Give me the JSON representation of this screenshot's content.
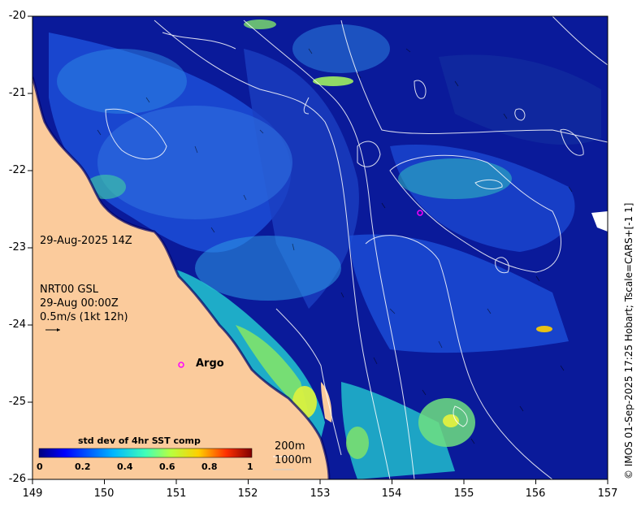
{
  "map": {
    "y_ticks": [
      "-20",
      "-21",
      "-22",
      "-23",
      "-24",
      "-25",
      "-26"
    ],
    "x_ticks": [
      "149",
      "150",
      "151",
      "152",
      "153",
      "154",
      "155",
      "156",
      "157"
    ],
    "lon_range": [
      149,
      157
    ],
    "lat_range": [
      -26,
      -20
    ]
  },
  "annotations": {
    "date": "29-Aug-2025 14Z",
    "nrt_line1": "NRT00 GSL",
    "nrt_line2": "29-Aug 00:00Z",
    "nrt_line3": "0.5m/s (1kt 12h)",
    "argo_label": "Argo",
    "depth_200": "200m",
    "depth_1000": "1000m",
    "credit": "© IMOS 01-Sep-2025 17:25 Hobart; Tscale=CARS+[-1 1]"
  },
  "colorbar": {
    "title": "std dev of 4hr SST comp",
    "ticks": [
      "0",
      "0.2",
      "0.4",
      "0.6",
      "0.8",
      "1"
    ],
    "range": [
      0,
      1
    ]
  },
  "colors": {
    "land": "#fbcb9c",
    "ocean_deep": "#0a1a9a",
    "ocean_mid": "#1c4fd8",
    "ocean_light": "#2e8ae6",
    "argo": "#ff00ff"
  }
}
